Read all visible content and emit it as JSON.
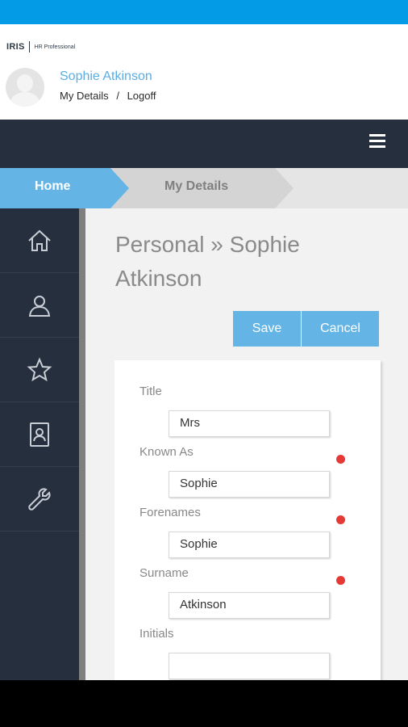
{
  "header": {
    "logo_text": "IRIS",
    "logo_subtitle": "HR Professional",
    "user_name": "Sophie Atkinson",
    "my_details_link": "My Details",
    "separator": "/",
    "logoff_link": "Logoff"
  },
  "breadcrumb": {
    "home": "Home",
    "current": "My Details"
  },
  "sidebar": {
    "items": [
      {
        "icon": "home-icon"
      },
      {
        "icon": "person-icon"
      },
      {
        "icon": "star-icon"
      },
      {
        "icon": "contact-card-icon"
      },
      {
        "icon": "wrench-icon"
      }
    ]
  },
  "main": {
    "title": "Personal » Sophie Atkinson",
    "save_label": "Save",
    "cancel_label": "Cancel"
  },
  "form": {
    "fields": [
      {
        "label": "Title",
        "value": "Mrs",
        "required": false
      },
      {
        "label": "Known As",
        "value": "Sophie",
        "required": true
      },
      {
        "label": "Forenames",
        "value": "Sophie",
        "required": true
      },
      {
        "label": "Surname",
        "value": "Atkinson",
        "required": true
      },
      {
        "label": "Initials",
        "value": "",
        "required": false
      }
    ]
  },
  "colors": {
    "accent": "#64b5e6",
    "status_bar": "#039be5",
    "dark_nav": "#262f3d",
    "required_dot": "#e53935"
  }
}
